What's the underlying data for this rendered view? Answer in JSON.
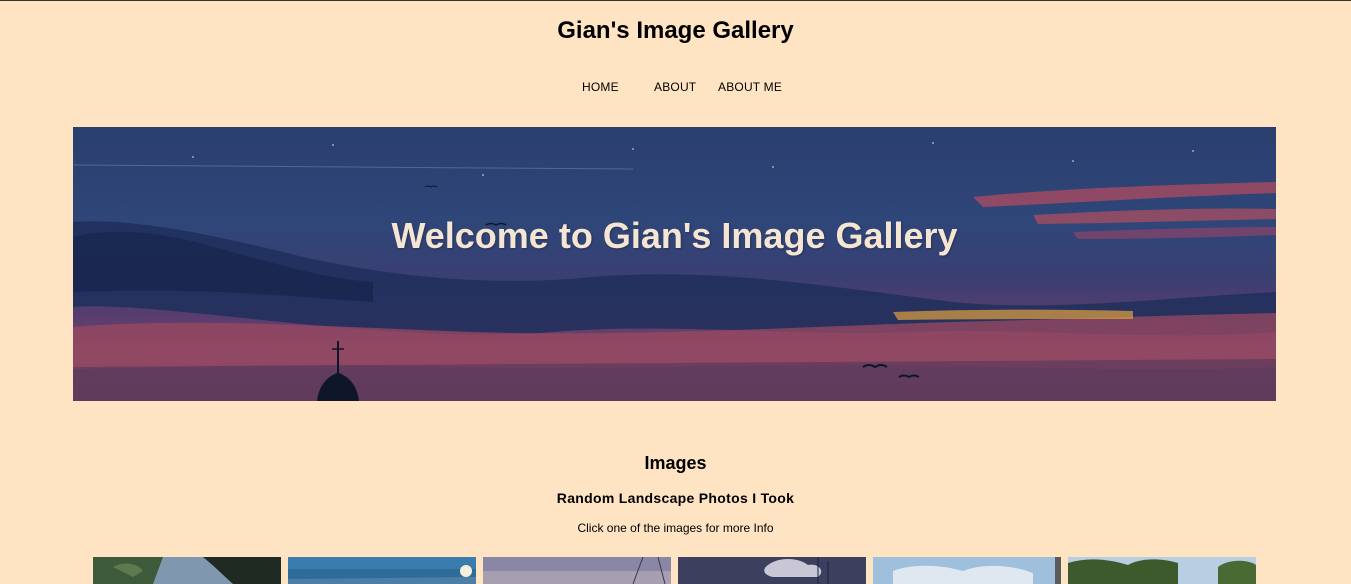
{
  "header": {
    "site_title": "Gian's Image Gallery"
  },
  "nav": {
    "items": [
      {
        "label": "HOME"
      },
      {
        "label": "ABOUT"
      },
      {
        "label": "ABOUT ME"
      }
    ]
  },
  "hero": {
    "title": "Welcome to Gian's Image Gallery"
  },
  "gallery": {
    "heading": "Images",
    "subheading": "Random Landscape Photos I Took",
    "note": "Click one of the images for more Info"
  },
  "colors": {
    "page_background": "#ffe4c4",
    "hero_title": "#f5e6d3",
    "text": "#000000"
  }
}
